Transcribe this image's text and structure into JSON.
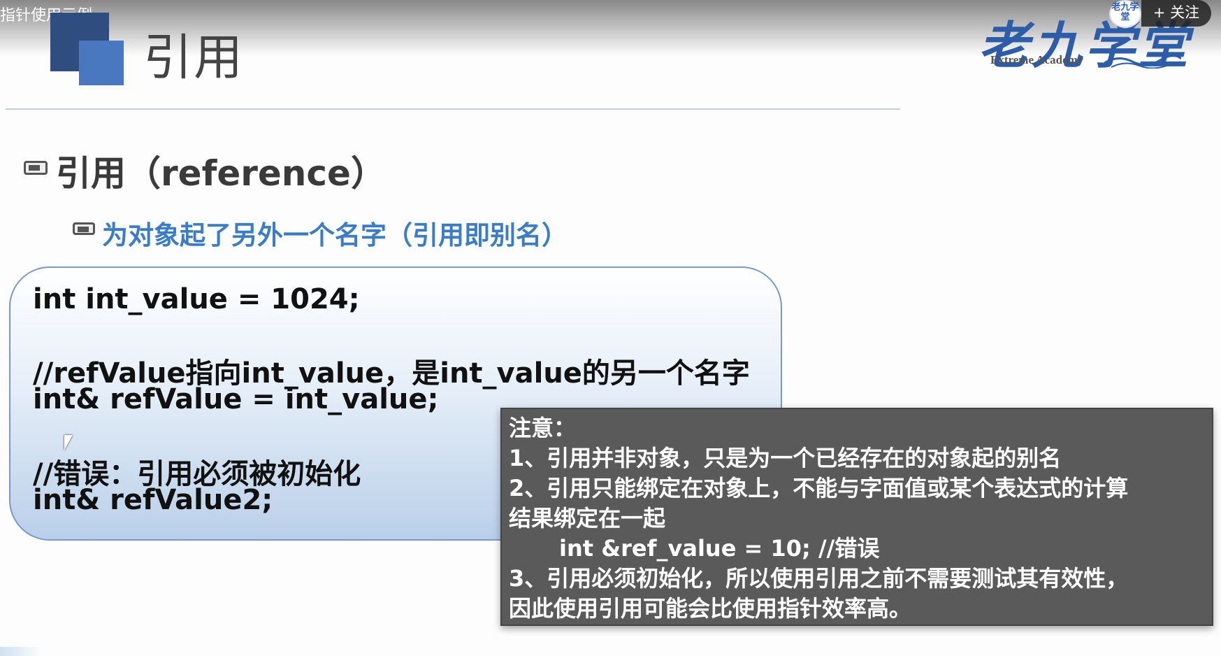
{
  "video": {
    "title": "指针使用示例"
  },
  "slide": {
    "title": "引用",
    "heading": "引用（reference）",
    "subheading": "为对象起了另外一个名字（引用即别名）",
    "code_lines": [
      "int int_value = 1024;",
      "//refValue指向int_value，是int_value的另一个名字",
      "int& refValue = int_value;",
      "//错误：引用必须被初始化",
      "int& refValue2;"
    ]
  },
  "logo": {
    "main": "老九学堂",
    "sub": "Extreme Academy"
  },
  "overlay": {
    "avatar_text": "老九学堂",
    "follow_label": "+ 关注"
  },
  "note": {
    "lines": [
      "注意：",
      "1、引用并非对象，只是为一个已经存在的对象起的别名",
      "2、引用只能绑定在对象上，不能与字面值或某个表达式的计算",
      "结果绑定在一起",
      "int &ref_value = 10;  //错误",
      "3、引用必须初始化，所以使用引用之前不需要测试其有效性，",
      "因此使用引用可能会比使用指针效率高。"
    ]
  },
  "colors": {
    "accent_blue": "#3b7cc4",
    "title_square_dark": "#2f4d7f",
    "title_square_light": "#4a78c0",
    "note_bg": "#5a5a5a"
  }
}
